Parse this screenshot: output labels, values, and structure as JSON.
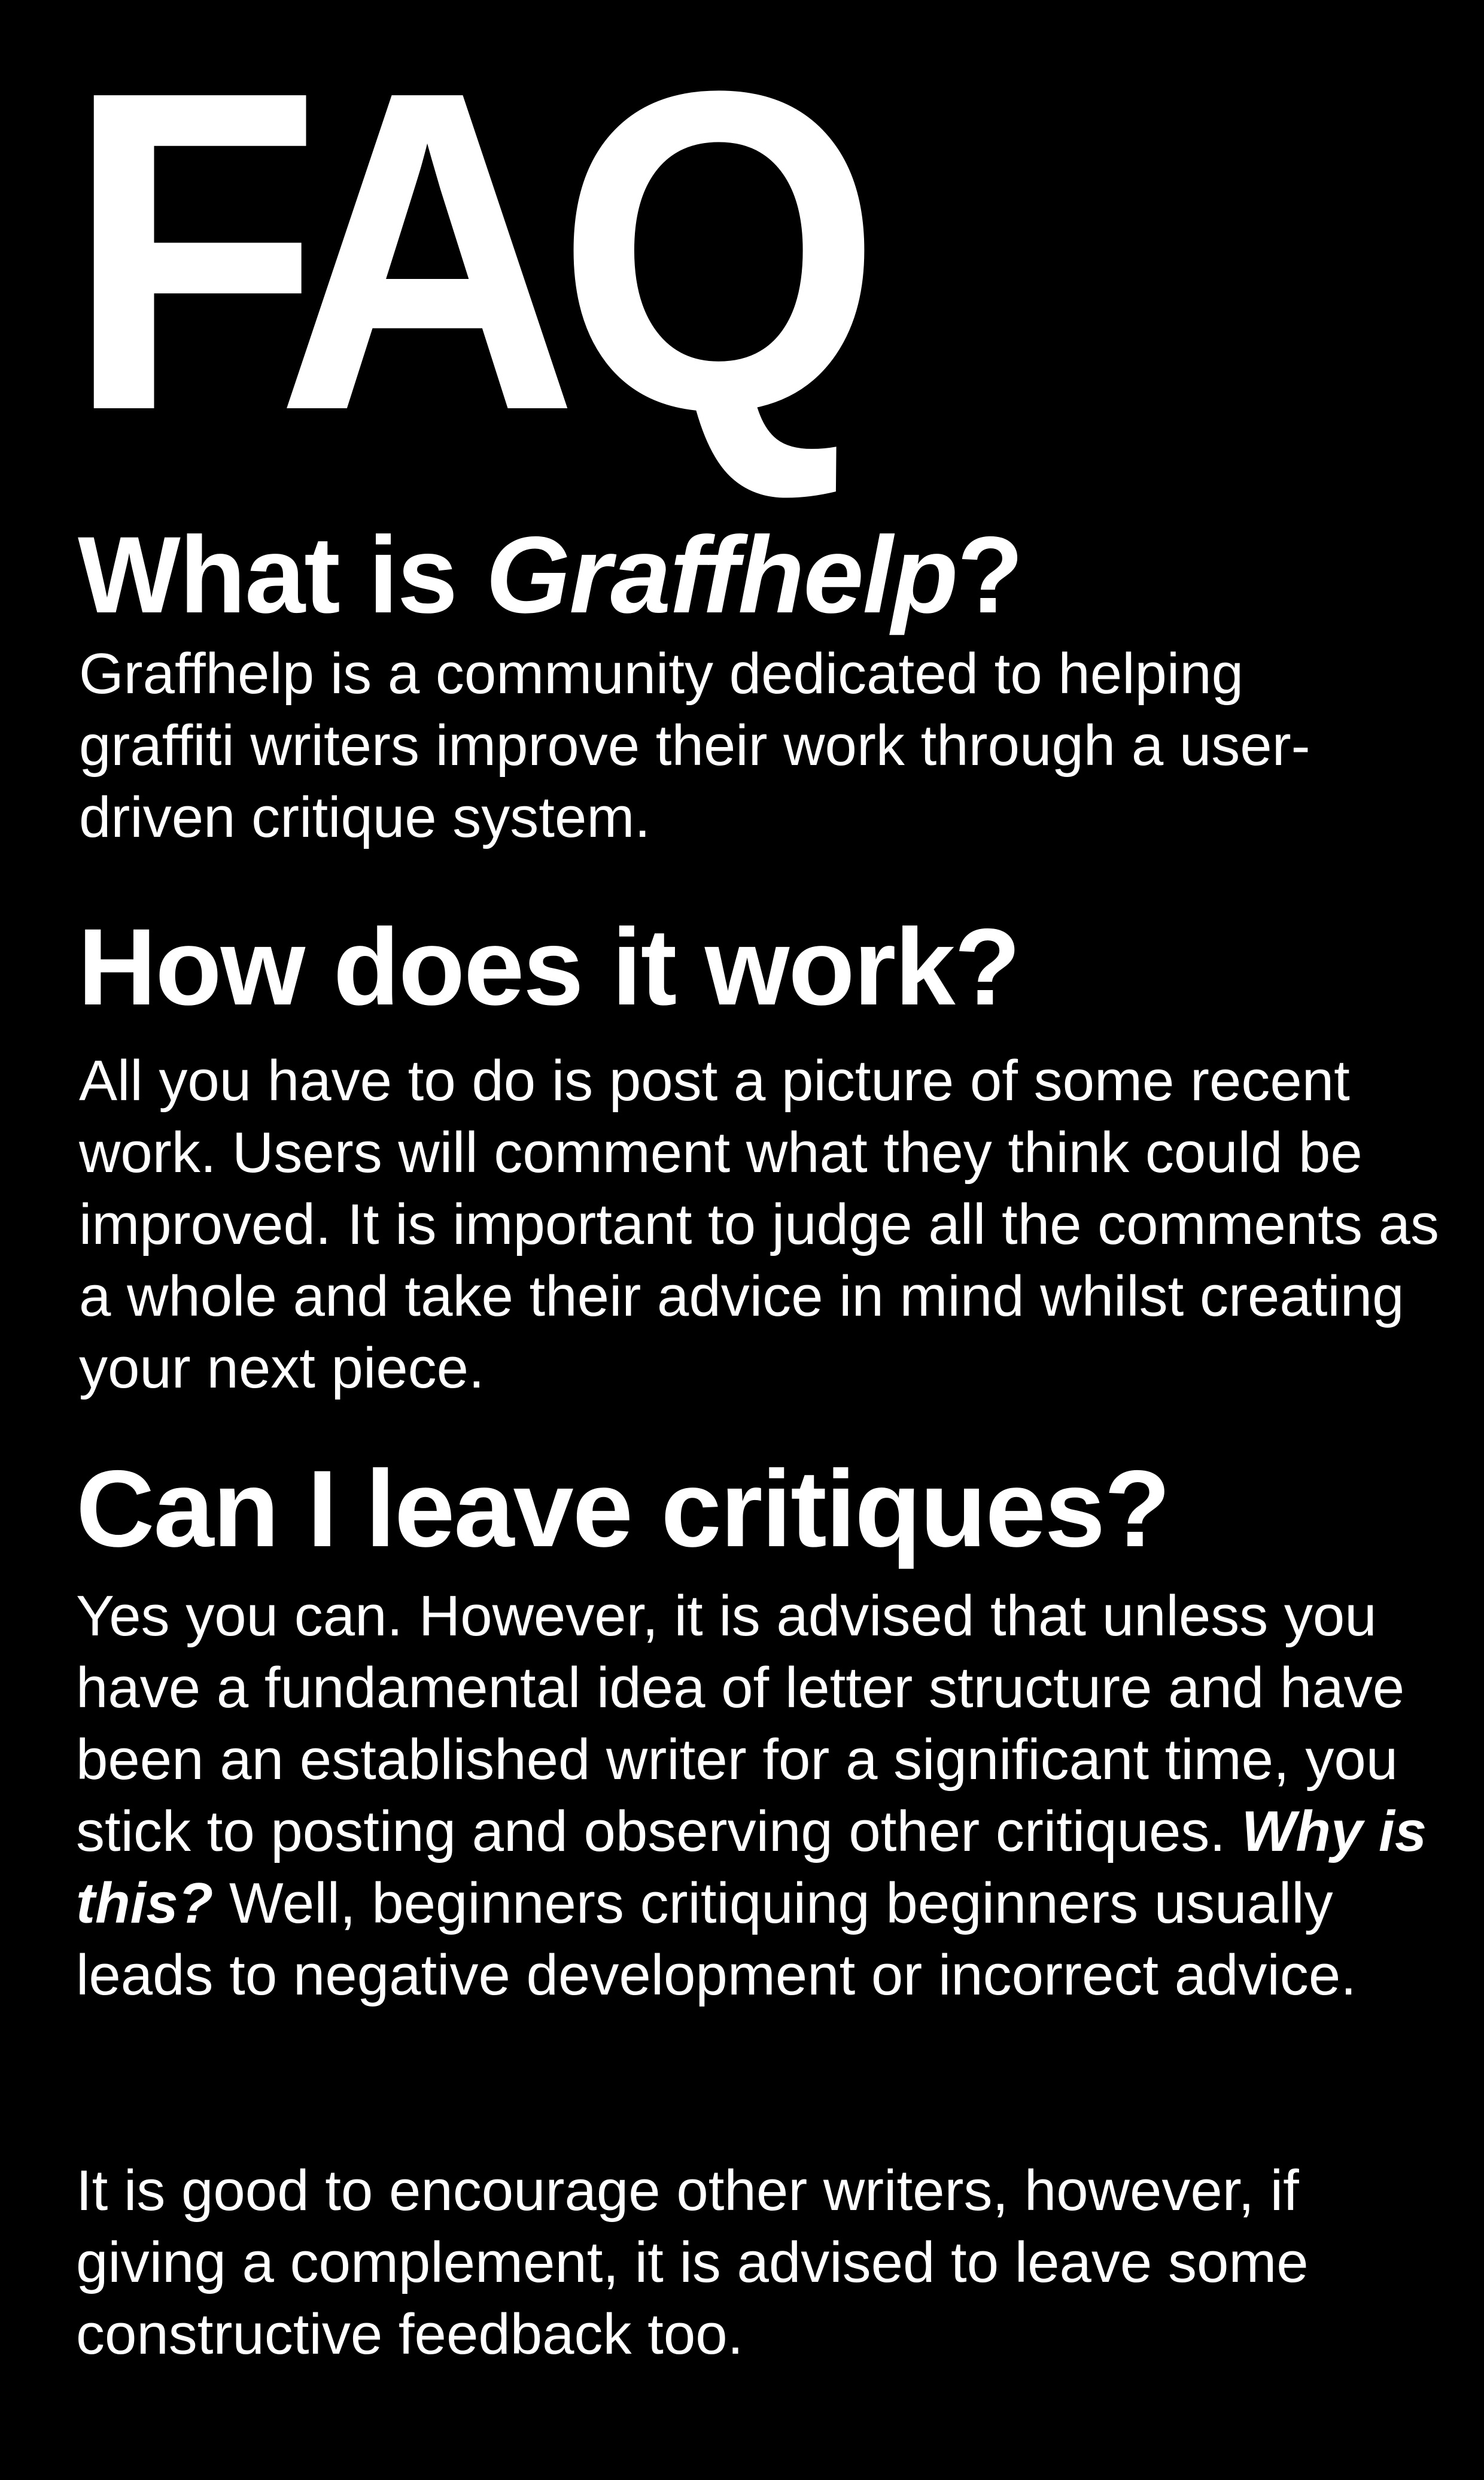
{
  "title": "FAQ",
  "colors": {
    "background": "#000000",
    "text": "#ffffff"
  },
  "faq": [
    {
      "question_before": "What is ",
      "question_emphasis": "Graffhelp",
      "question_after": "?",
      "answer": "Graffhelp is a community dedicated to helping graffiti writers improve their work through a user-driven critique system."
    },
    {
      "question": "How does it work?",
      "answer": "All you have to do is post a picture of some recent work. Users will comment what they think could be improved. It is important to judge all the comments as a whole and take their advice in mind whilst creating your next piece."
    },
    {
      "question": "Can I leave critiques?",
      "answer_before": "Yes you can. However, it is advised that unless you have a fundamental idea of letter structure and have been an established writer for a significant time, you stick to posting and observing other critiques. ",
      "answer_emphasis": "Why is this?",
      "answer_after": " Well, beginners critiquing beginners usually leads to negative development or incorrect advice.",
      "answer_2": "It is good to encourage other writers, however, if giving a complement, it is advised to leave some constructive feedback too."
    }
  ]
}
